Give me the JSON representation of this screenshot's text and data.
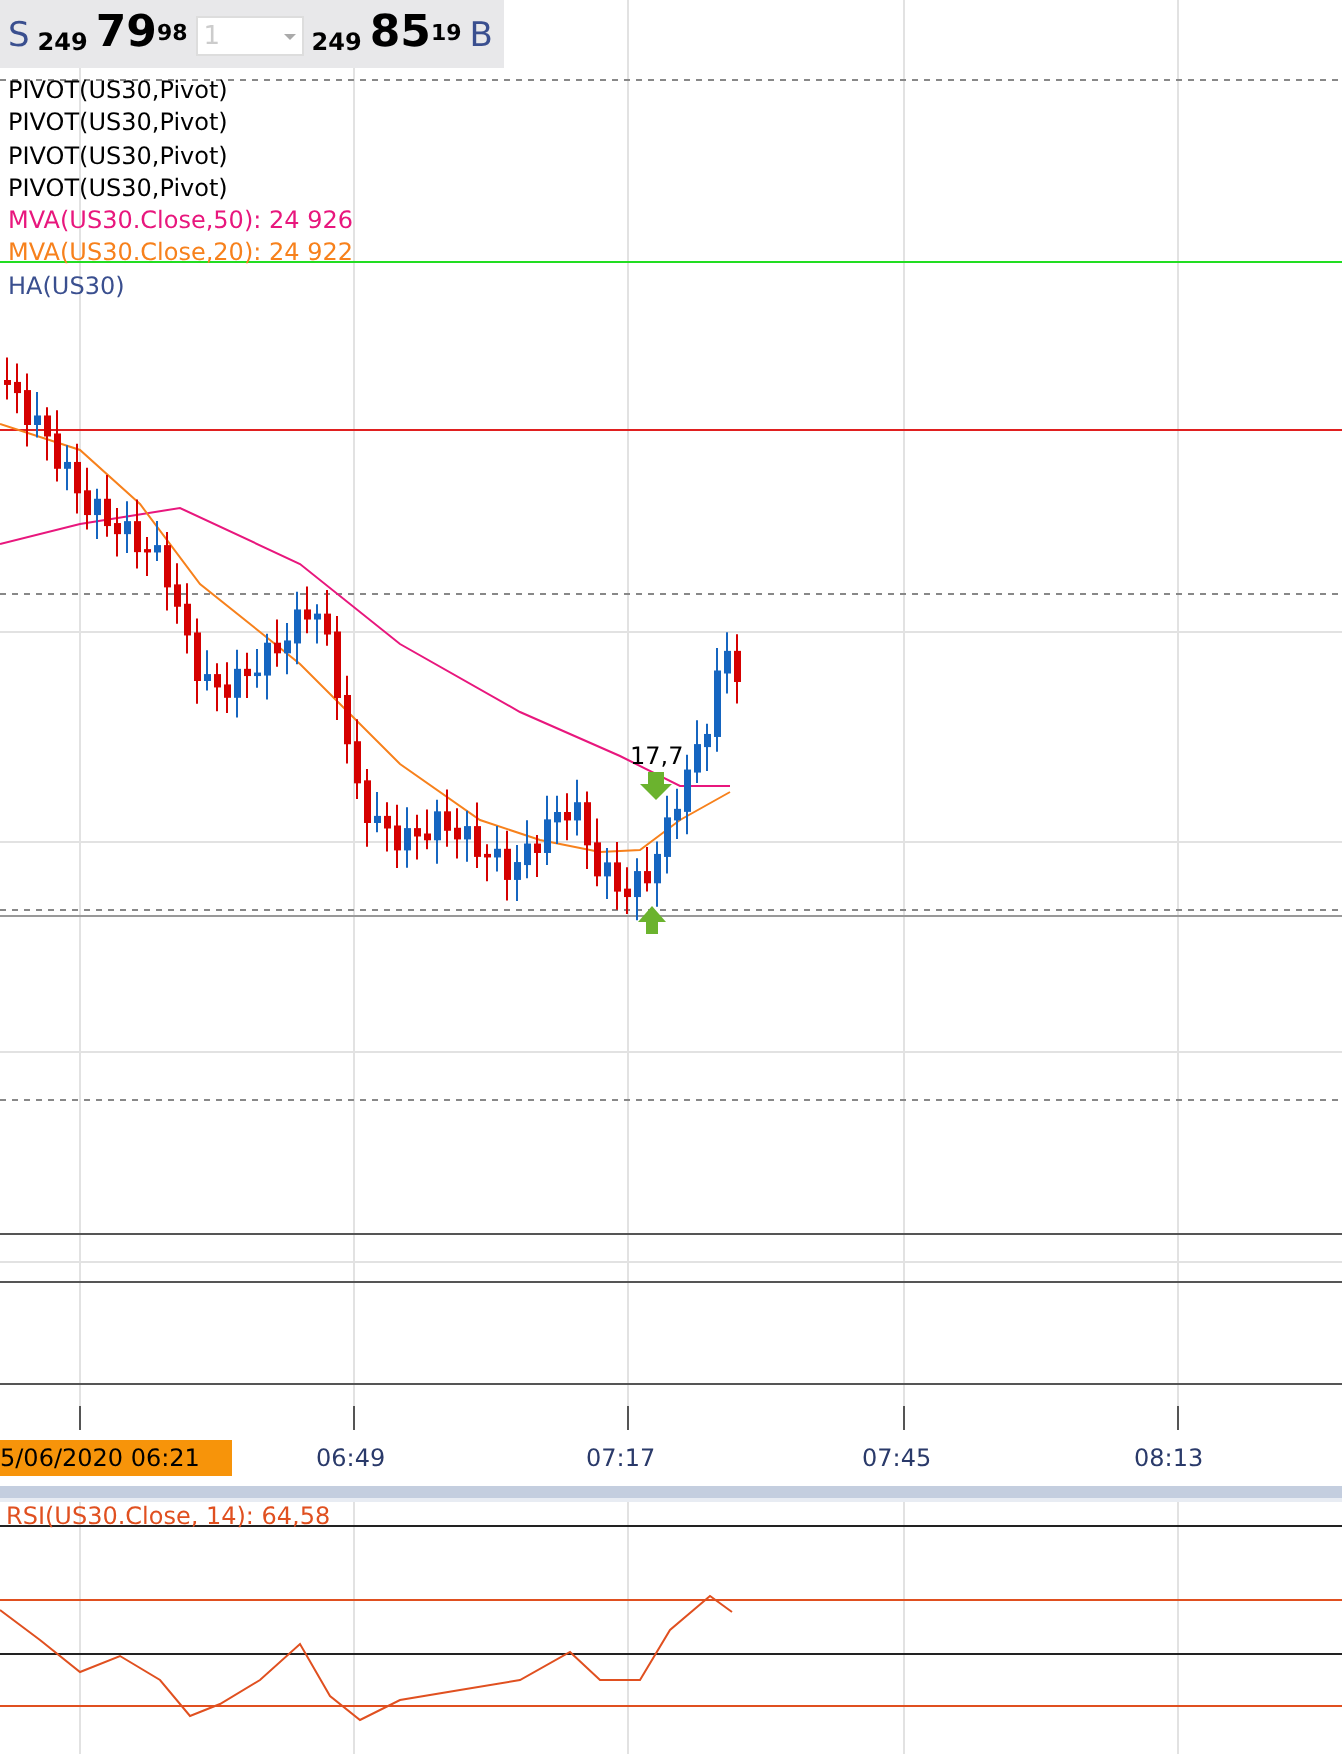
{
  "quote": {
    "sell_label": "S",
    "sell_big": "249",
    "sell_main": "79",
    "sell_sup": "98",
    "quantity": "1",
    "buy_big": "249",
    "buy_main": "85",
    "buy_sup": "19",
    "buy_label": "B"
  },
  "legend": [
    {
      "text": "PIVOT(US30,Pivot)",
      "color": "#000000"
    },
    {
      "text": "PIVOT(US30,Pivot)",
      "color": "#000000"
    },
    {
      "text": "PIVOT(US30,Pivot)",
      "color": "#000000"
    },
    {
      "text": "PIVOT(US30,Pivot)",
      "color": "#000000"
    },
    {
      "text": "MVA(US30.Close,50): 24 926",
      "color": "#e8177d"
    },
    {
      "text": "MVA(US30.Close,20): 24 922",
      "color": "#f7811c"
    },
    {
      "text": "HA(US30)",
      "color": "#3a4f8f"
    }
  ],
  "signal_label": "17,7",
  "time_axis": {
    "current": "5/06/2020 06:21",
    "ticks": [
      "06:49",
      "07:17",
      "07:45",
      "08:13"
    ]
  },
  "rsi": {
    "label": "RSI(US30.Close, 14): 64,58"
  }
}
